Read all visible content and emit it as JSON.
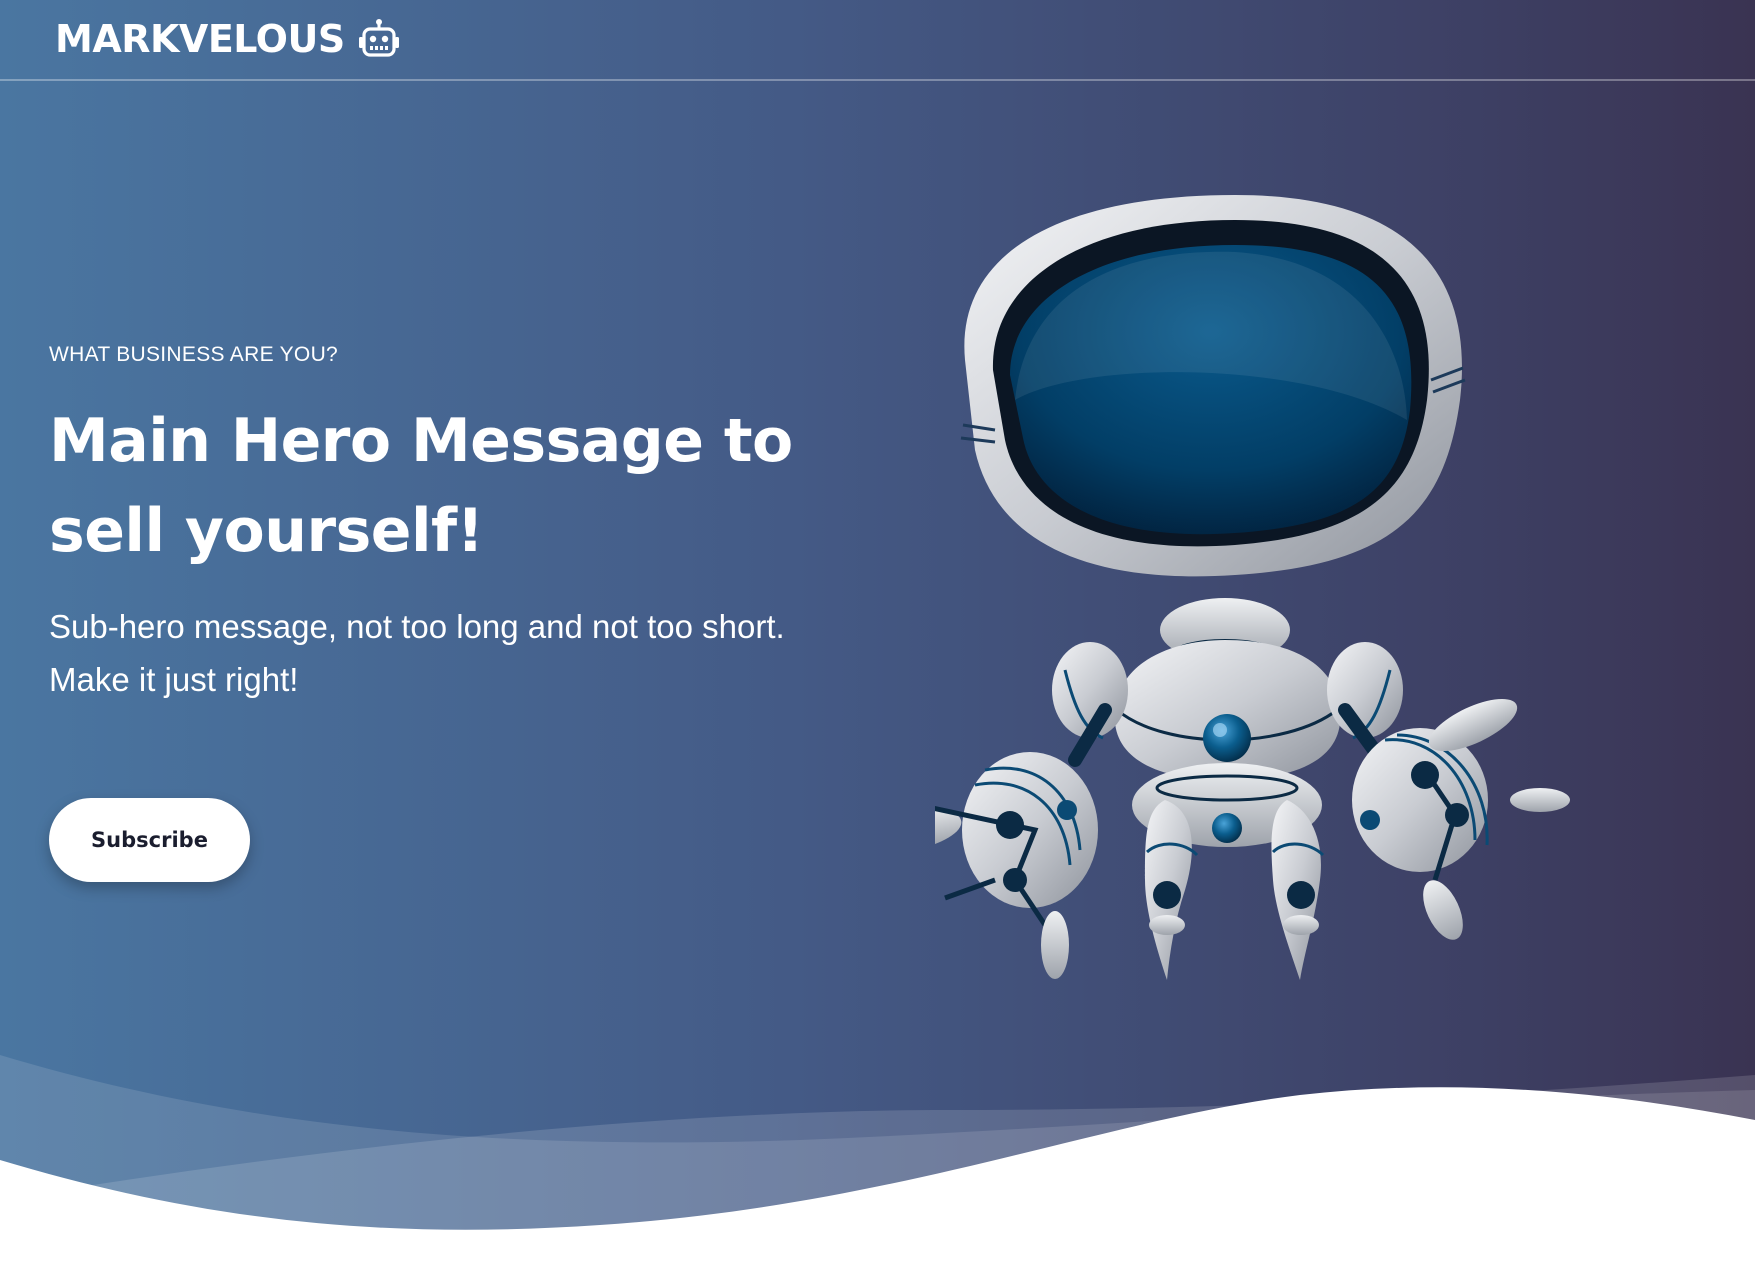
{
  "brand": {
    "name": "MARKVELOUS",
    "icon": "robot-icon"
  },
  "hero": {
    "eyebrow": "WHAT BUSINESS ARE YOU?",
    "headline": "Main Hero Message to sell yourself!",
    "subhero": "Sub-hero message, not too long and not too short. Make it just right!",
    "cta_label": "Subscribe",
    "illustration": "robot-illustration"
  },
  "colors": {
    "gradient_left": "#4a76a1",
    "gradient_right": "#3a3352",
    "button_bg": "#ffffff",
    "button_text": "#1a1d2e"
  }
}
